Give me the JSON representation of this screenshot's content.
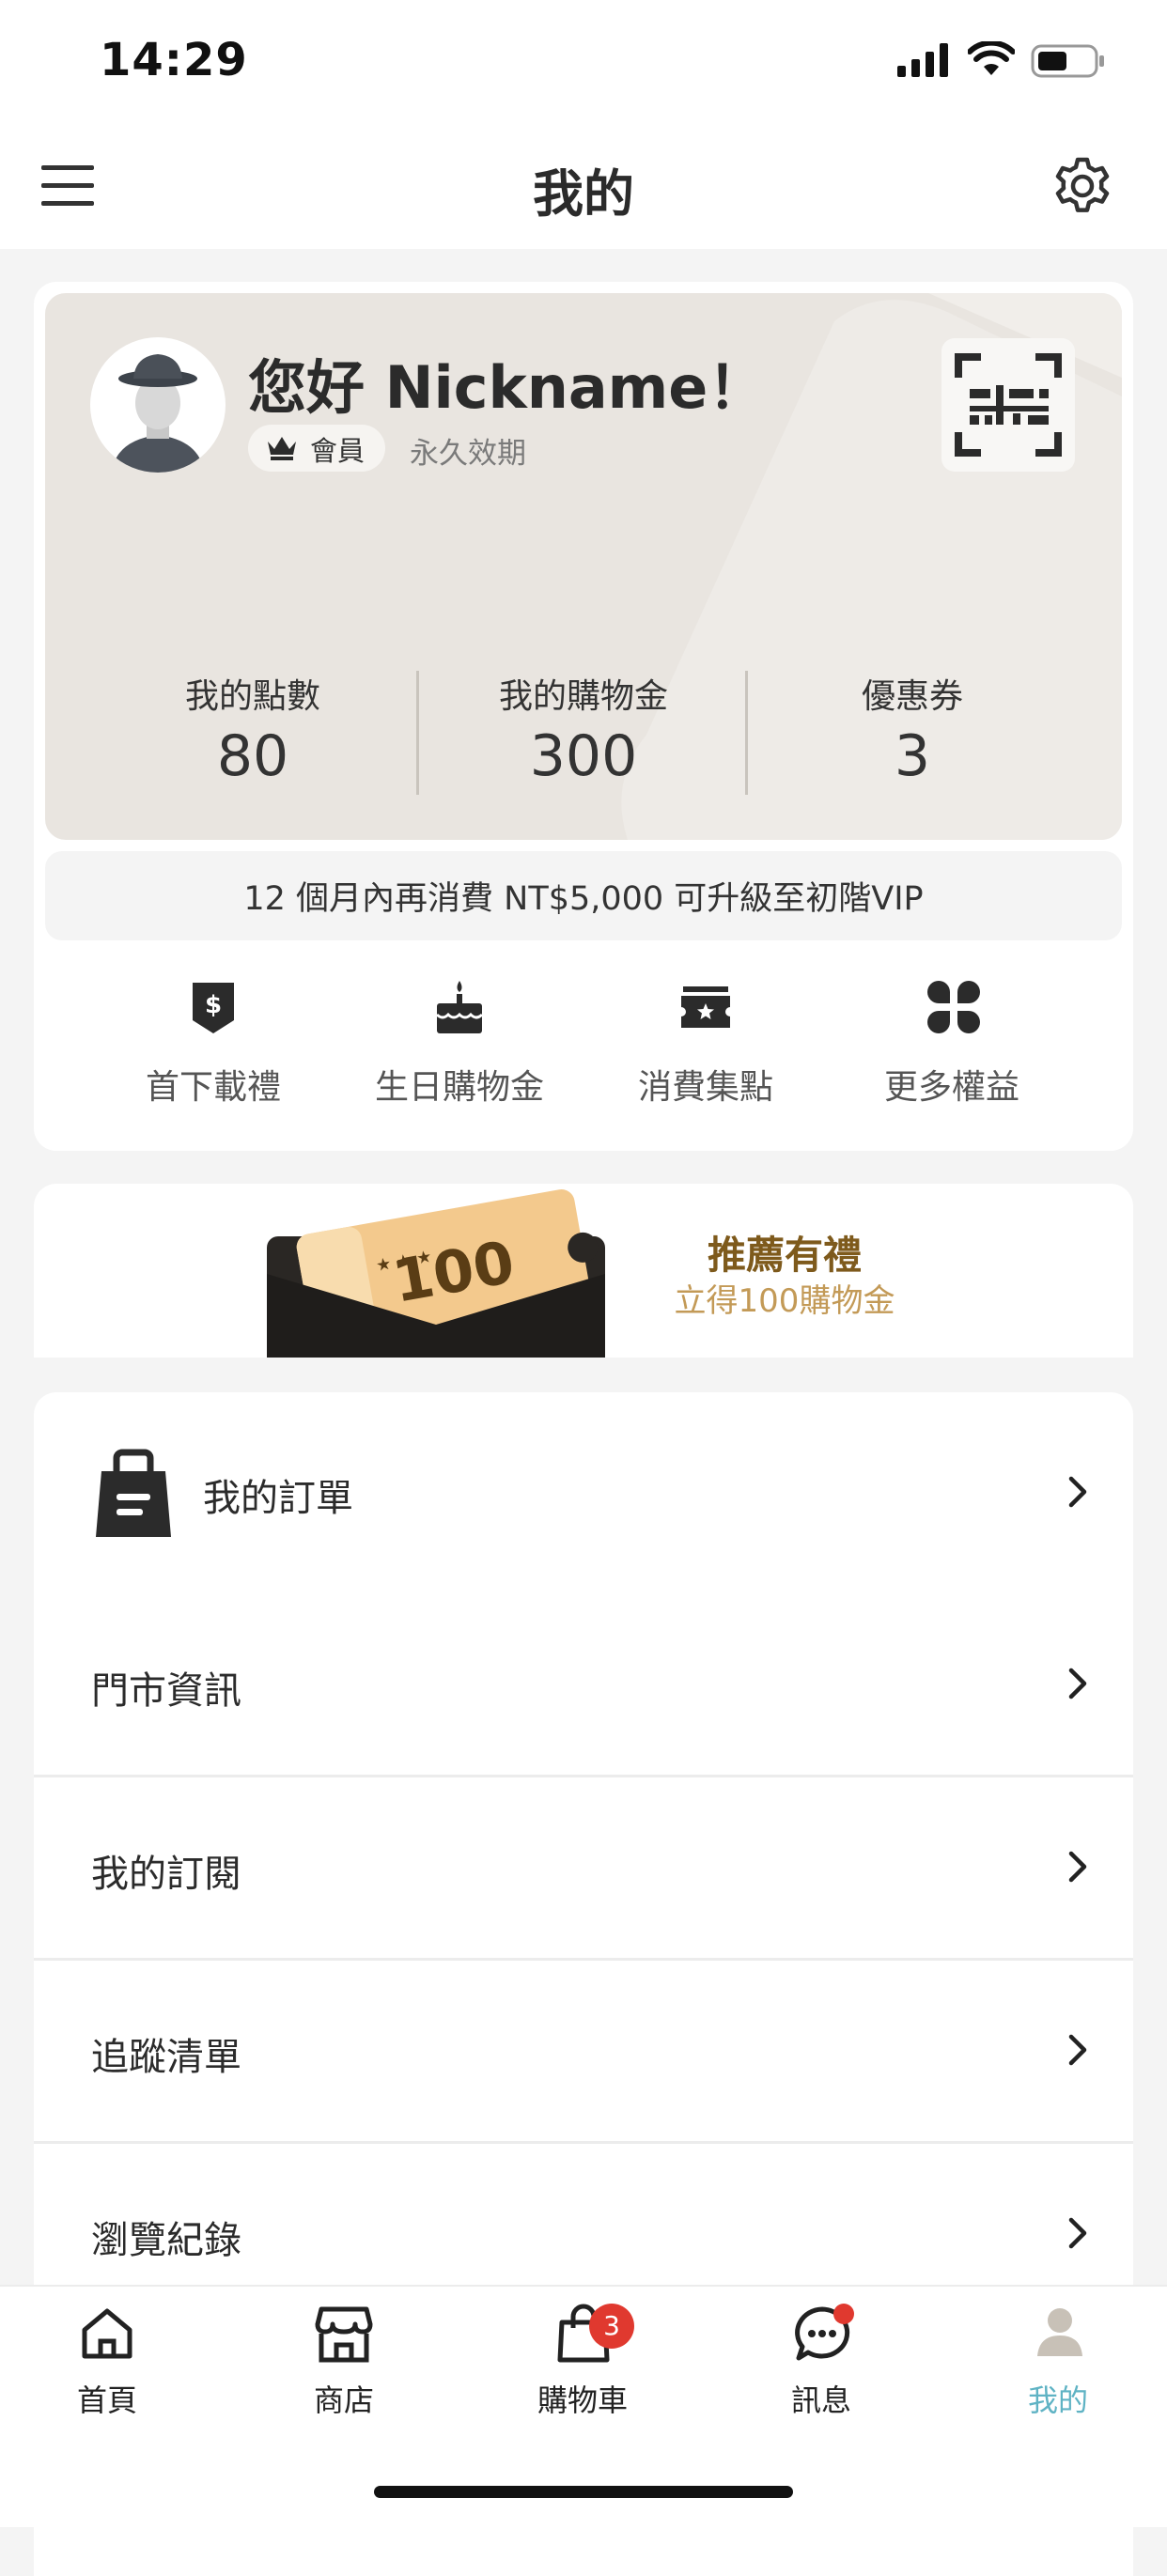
{
  "status_bar": {
    "time": "14:29"
  },
  "header": {
    "title": "我的"
  },
  "member": {
    "greeting": "您好 Nickname！",
    "tier": "會員",
    "validity": "永久效期",
    "stats": [
      {
        "label": "我的點數",
        "value": "80"
      },
      {
        "label": "我的購物金",
        "value": "300"
      },
      {
        "label": "優惠券",
        "value": "3"
      }
    ],
    "upgrade_text": "12 個月內再消費 NT$5,000 可升級至初階VIP"
  },
  "benefits": [
    {
      "label": "首下載禮",
      "icon": "download-gift-icon"
    },
    {
      "label": "生日購物金",
      "icon": "birthday-cake-icon"
    },
    {
      "label": "消費集點",
      "icon": "ticket-star-icon"
    },
    {
      "label": "更多權益",
      "icon": "more-grid-icon"
    }
  ],
  "referral_banner": {
    "ticket_value": "100",
    "title": "推薦有禮",
    "subtitle": "立得100購物金"
  },
  "menu": [
    {
      "label": "我的訂單",
      "icon": "shopping-bag-icon"
    },
    {
      "label": "門市資訊"
    },
    {
      "label": "我的訂閱"
    },
    {
      "label": "追蹤清單"
    },
    {
      "label": "瀏覽紀錄"
    }
  ],
  "tabbar": {
    "items": [
      {
        "label": "首頁",
        "icon": "home-icon"
      },
      {
        "label": "商店",
        "icon": "store-icon"
      },
      {
        "label": "購物車",
        "icon": "cart-bag-icon",
        "badge": "3"
      },
      {
        "label": "訊息",
        "icon": "message-icon"
      },
      {
        "label": "我的",
        "icon": "profile-icon",
        "active": true
      }
    ],
    "active_color": "#5fb3c4"
  },
  "colors": {
    "card_bg": "#e9e5e0",
    "banner_title": "#7e5a1c",
    "banner_sub": "#c39a57",
    "badge_red": "#e0392f"
  }
}
